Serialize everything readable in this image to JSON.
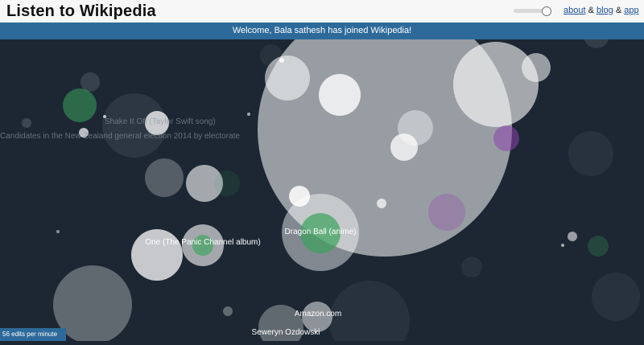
{
  "header": {
    "title": "Listen to Wikipedia",
    "links": {
      "about": "about",
      "sep1": "&",
      "blog": "blog",
      "sep2": "&",
      "app": "app"
    }
  },
  "volume": {
    "level": 0.8
  },
  "banner": {
    "message": "Welcome, Bala sathesh has joined Wikipedia!"
  },
  "faded_labels": [
    "Shake It Off (Taylor Swift song)",
    "Candidates in the New Zealand general election 2014 by electorate"
  ],
  "labels": [
    "Dragon Ball (anime)",
    "One (The Panic Channel album)",
    "Amazon.com",
    "Seweryn Ozdowski"
  ],
  "status": {
    "rate": "56 edits per minute"
  },
  "colors": {
    "background": "#1c2733",
    "banner": "#2d6a9a",
    "edit": "#ffffff",
    "new_user": "#3aa35b",
    "bot": "#8e44ad"
  }
}
